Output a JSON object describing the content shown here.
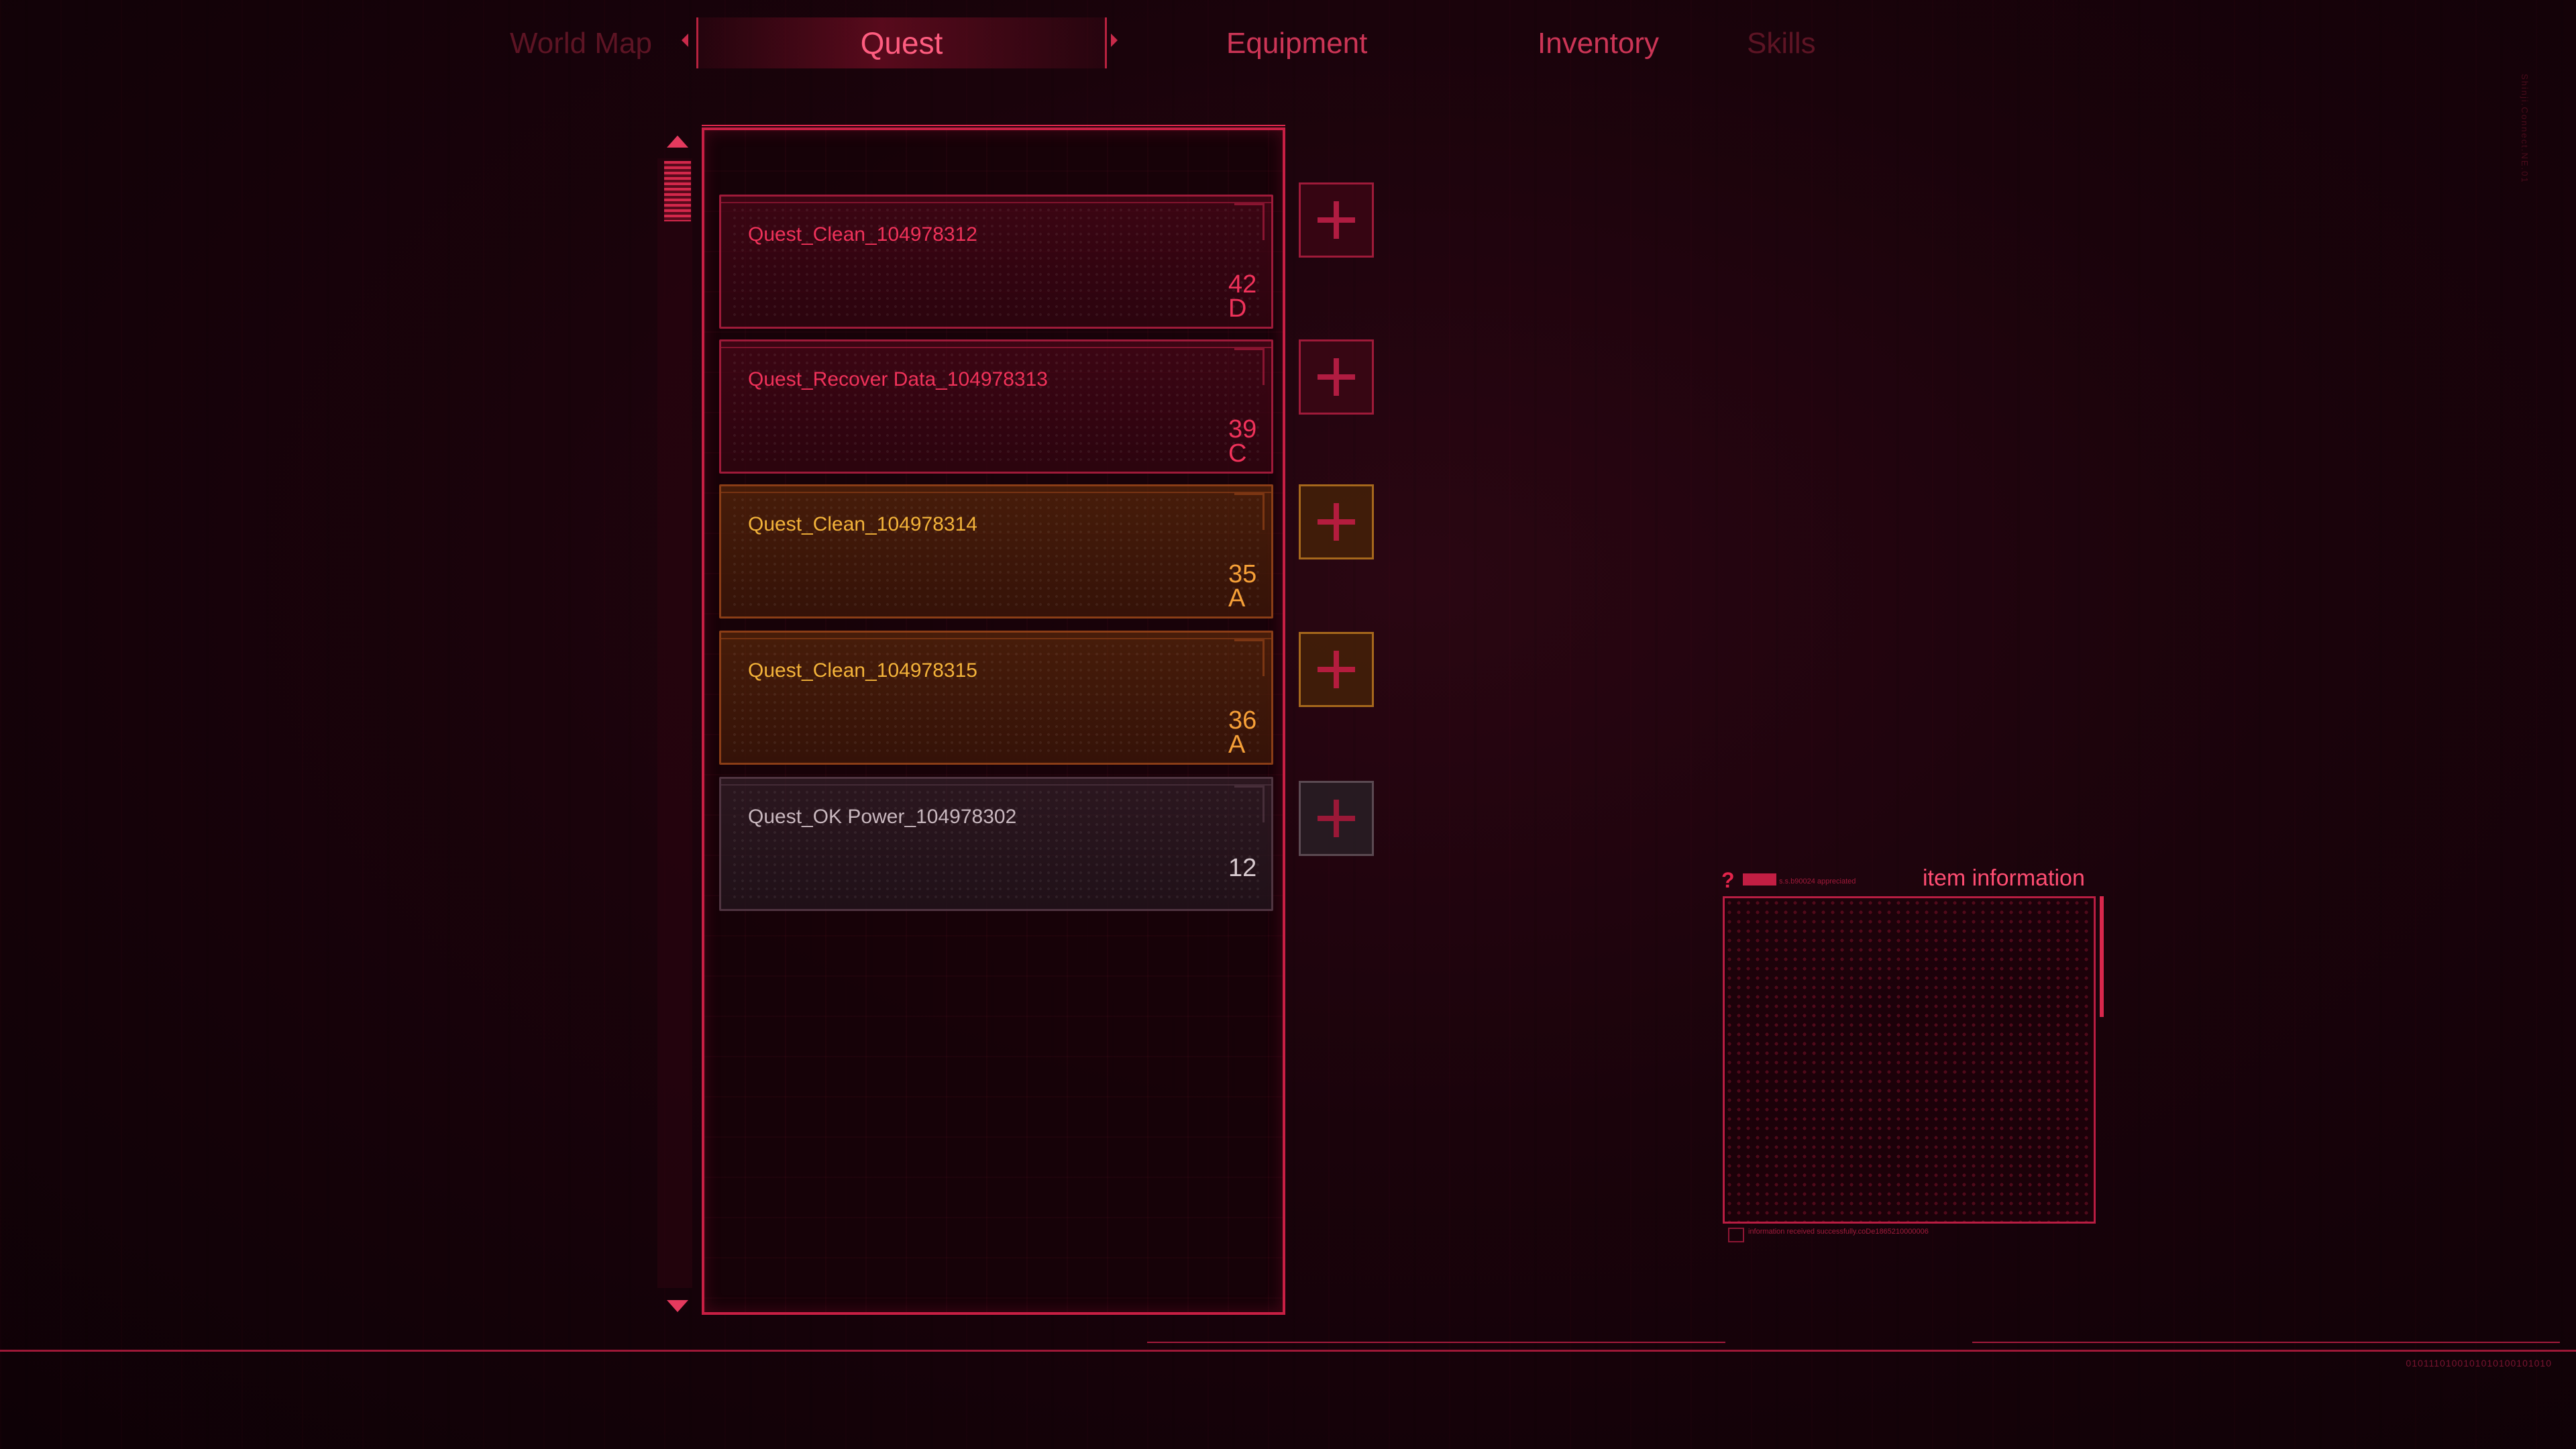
{
  "nav": {
    "tabs": [
      "World Map",
      "Quest",
      "Equipment",
      "Inventory",
      "Skills"
    ],
    "active": "Quest"
  },
  "quests": [
    {
      "name": "Quest_Clean_104978312",
      "level": "42",
      "grade": "D",
      "theme": "red"
    },
    {
      "name": "Quest_Recover Data_104978313",
      "level": "39",
      "grade": "C",
      "theme": "red"
    },
    {
      "name": "Quest_Clean_104978314",
      "level": "35",
      "grade": "A",
      "theme": "orange"
    },
    {
      "name": "Quest_Clean_104978315",
      "level": "36",
      "grade": "A",
      "theme": "orange"
    },
    {
      "name": "Quest_OK Power_104978302",
      "level": "12",
      "grade": "",
      "theme": "gray"
    }
  ],
  "add_button": {
    "icon": "plus-icon"
  },
  "item_info": {
    "title": "item information",
    "help_icon": "?",
    "micro_label": "s.s.b90024 appreciated",
    "footer": "information received successfully.coDe1865210000006"
  },
  "decor": {
    "binary": "0101110100101010100101010",
    "vertical_code": "Shinji.Connect.NE.01"
  },
  "colors": {
    "accent": "#e0284d",
    "grade_red": "#f0325a",
    "grade_orange": "#f6a038",
    "grade_gray": "#d8cad0"
  }
}
